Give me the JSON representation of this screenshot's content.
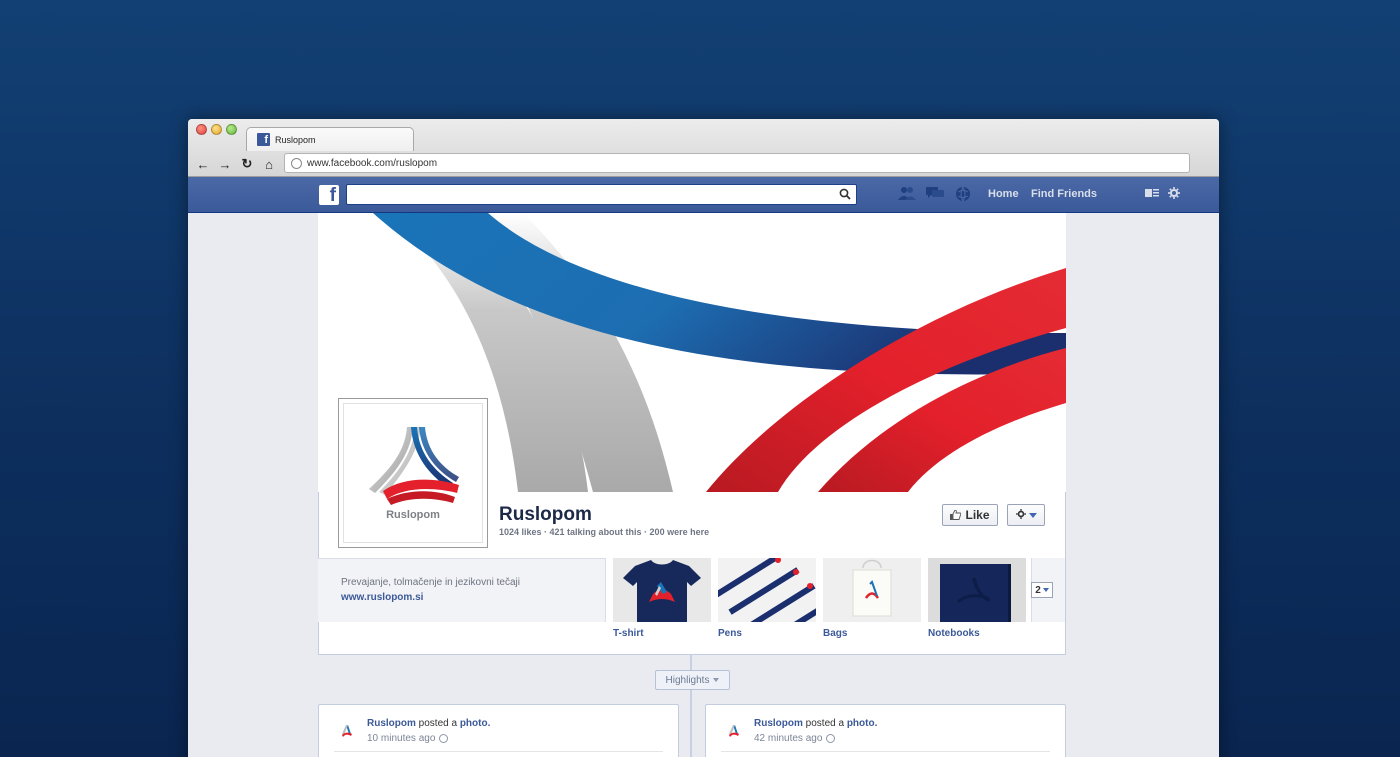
{
  "browser": {
    "tab_title": "Ruslopom",
    "url": "www.facebook.com/ruslopom",
    "nav": {
      "back": "←",
      "forward": "→",
      "reload": "↻",
      "home": "⌂"
    }
  },
  "fb_header": {
    "logo": "f",
    "search_placeholder": "",
    "links": {
      "home": "Home",
      "find_friends": "Find Friends"
    },
    "icons": [
      "friend-requests-icon",
      "messages-icon",
      "notifications-icon",
      "account-icon",
      "settings-icon"
    ]
  },
  "page": {
    "name": "Ruslopom",
    "stats": "1024 likes · 421 talking about this · 200 were here",
    "profile_label": "Ruslopom",
    "like_label": "Like",
    "about": {
      "description": "Prevajanje, tolmačenje in jezikovni tečaji",
      "website": "www.ruslopom.si"
    },
    "apps": [
      {
        "label": "T-shirt"
      },
      {
        "label": "Pens"
      },
      {
        "label": "Bags"
      },
      {
        "label": "Notebooks"
      }
    ],
    "more_count": "2"
  },
  "timeline": {
    "highlights_label": "Highlights",
    "posts": [
      {
        "author": "Ruslopom",
        "action": "posted a",
        "object": "photo.",
        "time": "10 minutes ago"
      },
      {
        "author": "Ruslopom",
        "action": "posted a",
        "object": "photo.",
        "time": "42 minutes ago"
      }
    ]
  },
  "colors": {
    "background": "#0f3466",
    "fb_blue": "#3b5998",
    "brand_blue": "#1a74b8",
    "brand_red": "#e3202b",
    "brand_gray": "#bdbdbd"
  }
}
